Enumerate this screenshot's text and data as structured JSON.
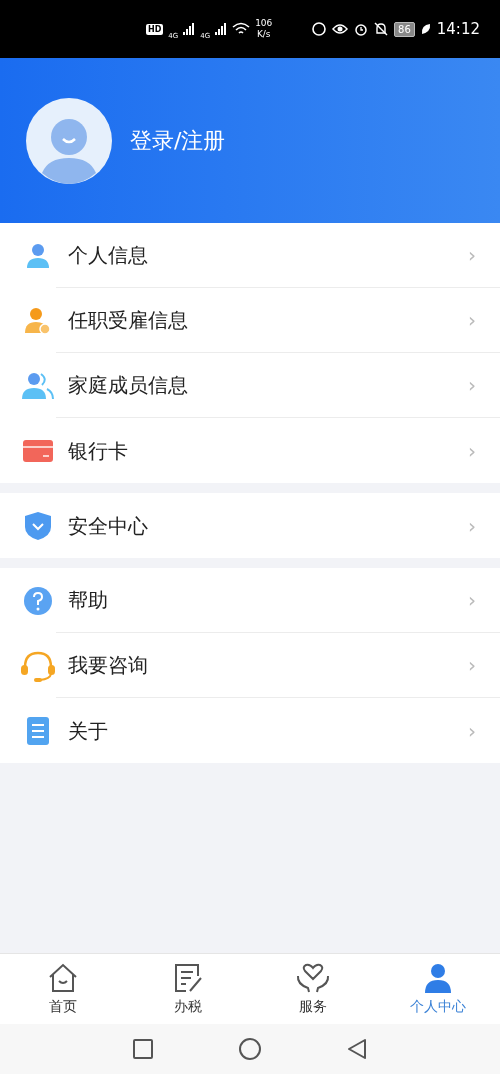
{
  "status_bar": {
    "hd": "HD",
    "network_1": "4G",
    "network_2": "4G",
    "speed_value": "106",
    "speed_unit": "K/s",
    "battery": "86",
    "time": "14:12"
  },
  "header": {
    "login_label": "登录/注册"
  },
  "menu_groups": [
    {
      "items": [
        {
          "label": "个人信息",
          "chevron": "›"
        },
        {
          "label": "任职受雇信息",
          "chevron": "›"
        },
        {
          "label": "家庭成员信息",
          "chevron": "›"
        },
        {
          "label": "银行卡",
          "chevron": "›"
        }
      ]
    },
    {
      "items": [
        {
          "label": "安全中心",
          "chevron": "›"
        }
      ]
    },
    {
      "items": [
        {
          "label": "帮助",
          "chevron": "›"
        },
        {
          "label": "我要咨询",
          "chevron": "›"
        },
        {
          "label": "关于",
          "chevron": "›"
        }
      ]
    }
  ],
  "tab_bar": [
    {
      "label": "首页",
      "selected": false
    },
    {
      "label": "办税",
      "selected": false
    },
    {
      "label": "服务",
      "selected": false
    },
    {
      "label": "个人中心",
      "selected": true
    }
  ]
}
